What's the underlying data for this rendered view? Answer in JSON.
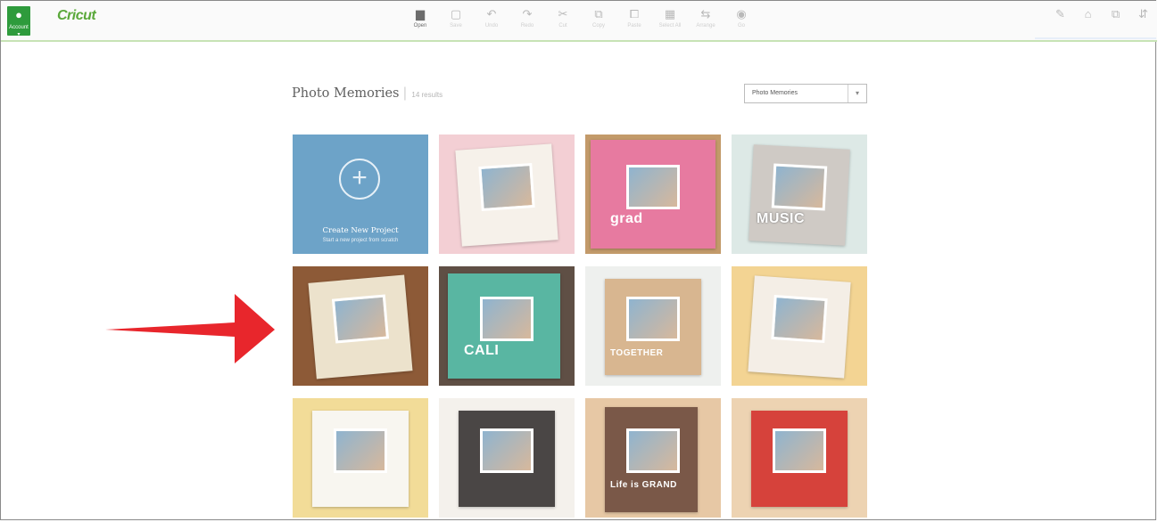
{
  "header": {
    "account_icon": "user-icon",
    "account_label": "Account ▾",
    "logo": "Cricut",
    "tools": [
      {
        "icon": "folder-icon",
        "label": "Open",
        "glyph": "▆"
      },
      {
        "icon": "save-icon",
        "label": "Save",
        "glyph": "▢"
      },
      {
        "icon": "undo-icon",
        "label": "Undo",
        "glyph": "↶"
      },
      {
        "icon": "redo-icon",
        "label": "Redo",
        "glyph": "↷"
      },
      {
        "icon": "cut-icon",
        "label": "Cut",
        "glyph": "✂"
      },
      {
        "icon": "copy-icon",
        "label": "Copy",
        "glyph": "⧉"
      },
      {
        "icon": "paste-icon",
        "label": "Paste",
        "glyph": "⧠"
      },
      {
        "icon": "select-all-icon",
        "label": "Select All",
        "glyph": "▦"
      },
      {
        "icon": "arrange-icon",
        "label": "Arrange",
        "glyph": "⇆"
      },
      {
        "icon": "settings-icon",
        "label": "Go",
        "glyph": "◉"
      }
    ],
    "right_tools": [
      {
        "icon": "edit-icon",
        "label": "",
        "glyph": "✎"
      },
      {
        "icon": "weld-icon",
        "label": "",
        "glyph": "⌂"
      },
      {
        "icon": "attach-icon",
        "label": "",
        "glyph": "⧉"
      },
      {
        "icon": "flip-icon",
        "label": "",
        "glyph": "⇵"
      }
    ]
  },
  "main": {
    "title": "Photo Memories",
    "count": "14 results",
    "category_select": "Photo Memories",
    "new_project": {
      "title": "Create New Project",
      "subtitle": "Start a new project from scratch"
    },
    "tiles": [
      {
        "name": "baby-photo-card",
        "bg": "#f3cfd4",
        "page": "#f6f1ea"
      },
      {
        "name": "graduate-flower-layout",
        "bg": "#c39a6a",
        "page": "#e77aa0",
        "text": "grad"
      },
      {
        "name": "music-layout",
        "bg": "#dde9e6",
        "page": "#cfcac5",
        "text": "MUSIC"
      },
      {
        "name": "boy-sailboat-layout",
        "bg": "#8d5a37",
        "page": "#ece2cc"
      },
      {
        "name": "camera-frame-layout",
        "bg": "#5f4f45",
        "page": "#59b6a2",
        "text": "CALI"
      },
      {
        "name": "together-layout",
        "bg": "#eef0ee",
        "page": "#d8b690",
        "text": "TOGETHER"
      },
      {
        "name": "friends-strip-layout",
        "bg": "#f3d493",
        "page": "#f4eee6"
      },
      {
        "name": "chevron-girl-layout",
        "bg": "#f2dc98",
        "page": "#f8f6f0"
      },
      {
        "name": "forest-couple-layout",
        "bg": "#f4f1ec",
        "page": "#4a4645"
      },
      {
        "name": "life-is-grand-layout",
        "bg": "#e7c8a5",
        "page": "#7a5848",
        "text": "Life is GRAND"
      },
      {
        "name": "birthday-cake-layout",
        "bg": "#edd3b2",
        "page": "#d6423b"
      }
    ]
  },
  "annotation": {
    "color": "#e8262c"
  }
}
